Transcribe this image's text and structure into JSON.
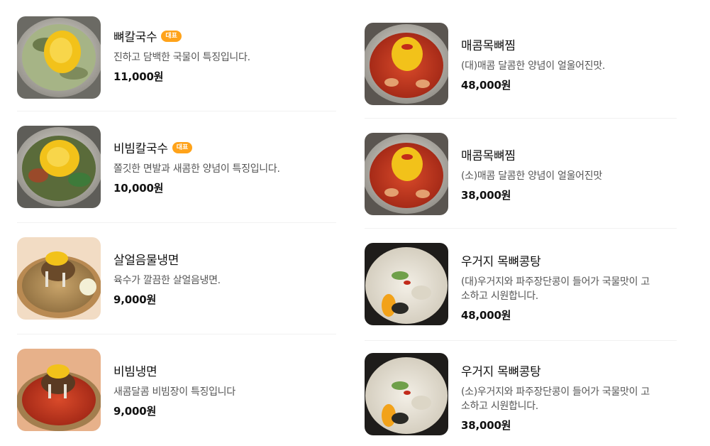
{
  "colors": {
    "badge": "#ffa31a",
    "divider": "#f1f1f1",
    "text_main": "#111111",
    "text_sub": "#555555"
  },
  "left_menu": [
    {
      "name": "뼈칼국수",
      "badge": "대표",
      "description": "진하고 담백한 국물이 특징입니다.",
      "price": "11,000원",
      "image": "bone-kalguksu-photo"
    },
    {
      "name": "비빔칼국수",
      "badge": "대표",
      "description": "쫄깃한 면발과 새콤한 양념이 특징입니다.",
      "price": "10,000원",
      "image": "bibim-kalguksu-photo"
    },
    {
      "name": "살얼음물냉면",
      "badge": "",
      "description": "육수가 깔끔한 살얼음냉면.",
      "price": "9,000원",
      "image": "mul-naengmyeon-photo"
    },
    {
      "name": "비빔냉면",
      "badge": "",
      "description": "새콤달콤 비빔장이 특징입니다",
      "price": "9,000원",
      "image": "bibim-naengmyeon-photo"
    }
  ],
  "right_menu": [
    {
      "name": "매콤목뼈찜",
      "description": "(대)매콤 달콤한 양념이 얼울어진맛.",
      "price": "48,000원",
      "image": "spicy-neckbone-jjim-photo"
    },
    {
      "name": "매콤목뼈찜",
      "description": "(소)매콤 달콤한 양념이 얼울어진맛",
      "price": "38,000원",
      "image": "spicy-neckbone-jjim-photo"
    },
    {
      "name": "우거지 목뼈콩탕",
      "description_line1": "(대)우거지와 파주장단콩이 들어가 국물맛이 고",
      "description_line2": "소하고 시원합니다.",
      "price": "48,000원",
      "image": "neckbone-kongtang-photo"
    },
    {
      "name": "우거지 목뼈콩탕",
      "description_line1": "(소)우거지와 파주장단콩이 들어가 국물맛이 고",
      "description_line2": "소하고 시원합니다.",
      "price": "38,000원",
      "image": "neckbone-kongtang-photo"
    }
  ]
}
